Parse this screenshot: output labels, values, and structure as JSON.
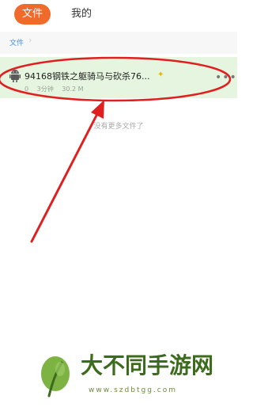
{
  "tabs": {
    "files_label": "文件",
    "mine_label": "我的",
    "active": "files"
  },
  "breadcrumb": {
    "root_label": "文件"
  },
  "file_list": {
    "items": [
      {
        "name": "94168钢铁之躯骑马与砍杀76...",
        "meta_0": "0",
        "meta_1": "3分钟",
        "size": "30.2 M",
        "icon": "android-icon",
        "starred": true
      }
    ],
    "end_text": "没有更多文件了"
  },
  "colors": {
    "accent": "#f06a2a",
    "highlight_row": "#e6f5e0",
    "annotation": "#e02020",
    "link": "#4a8fd8"
  },
  "watermark": {
    "title": "大不同手游网",
    "url": "www.szdbtgg.com"
  }
}
